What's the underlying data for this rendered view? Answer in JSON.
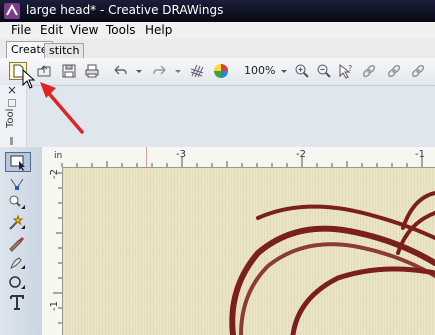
{
  "window": {
    "title": "large head* - Creative DRAWings"
  },
  "menu": {
    "items": [
      "File",
      "Edit",
      "View",
      "Tools",
      "Help"
    ]
  },
  "tabs": [
    {
      "label": "Create"
    },
    {
      "label": "stitch"
    }
  ],
  "toolbar": {
    "zoom": "100%"
  },
  "dock": {
    "caption": "Tool",
    "close": "×"
  },
  "ruler": {
    "unit": "in",
    "top_labels": [
      "-3",
      "-2",
      "-1"
    ],
    "left_labels": [
      "-2",
      "-1"
    ]
  },
  "icons": [
    "app-icon",
    "new-file-icon",
    "open-file-icon",
    "save-icon",
    "print-icon",
    "undo-icon",
    "redo-icon",
    "thread-palette-icon",
    "color-wheel-icon",
    "zoom-in-icon",
    "zoom-out-icon",
    "help-icon",
    "link-icon",
    "select-tool-icon",
    "node-edit-icon",
    "zoom-tool-icon",
    "magic-wand-icon",
    "pen-tool-icon",
    "brush-tool-icon",
    "ellipse-tool-icon",
    "text-tool-icon",
    "mouse-cursor-icon"
  ],
  "colors": {
    "titlebar": "#0d1022",
    "stitch": "#7a1f1c",
    "canvas": "#e9e2c4",
    "annotation_arrow": "#e02424"
  }
}
